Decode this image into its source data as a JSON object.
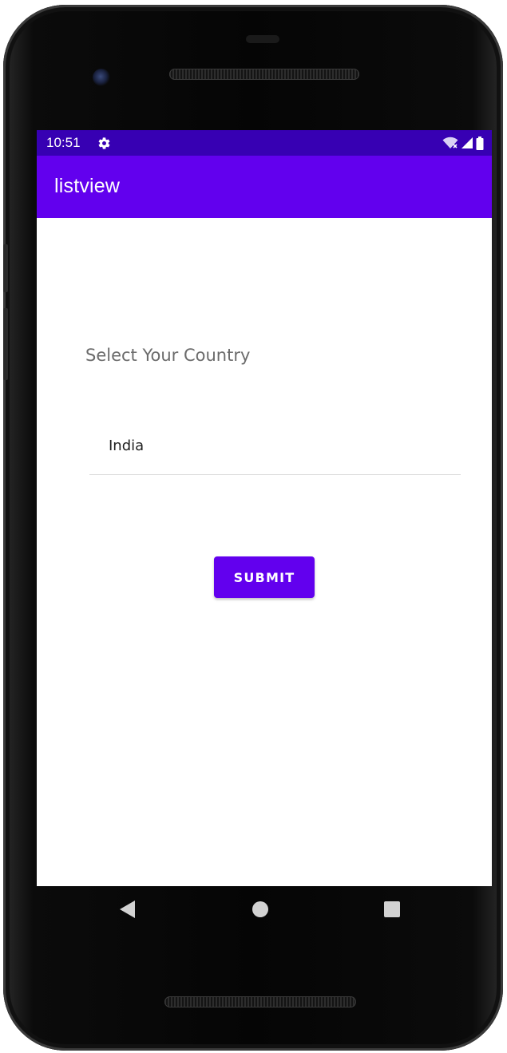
{
  "status_bar": {
    "time": "10:51",
    "icons": [
      "gear-icon",
      "wifi-icon",
      "signal-icon",
      "battery-icon"
    ],
    "background": "#3700b3"
  },
  "app_bar": {
    "title": "listview",
    "background": "#6200ee"
  },
  "form": {
    "prompt": "Select Your Country",
    "spinner_value": "India",
    "submit_label": "SUBMIT"
  },
  "nav_bar": {
    "icons": [
      "back-icon",
      "home-icon",
      "recents-icon"
    ]
  },
  "colors": {
    "accent": "#6200ee",
    "status": "#3700b3"
  }
}
